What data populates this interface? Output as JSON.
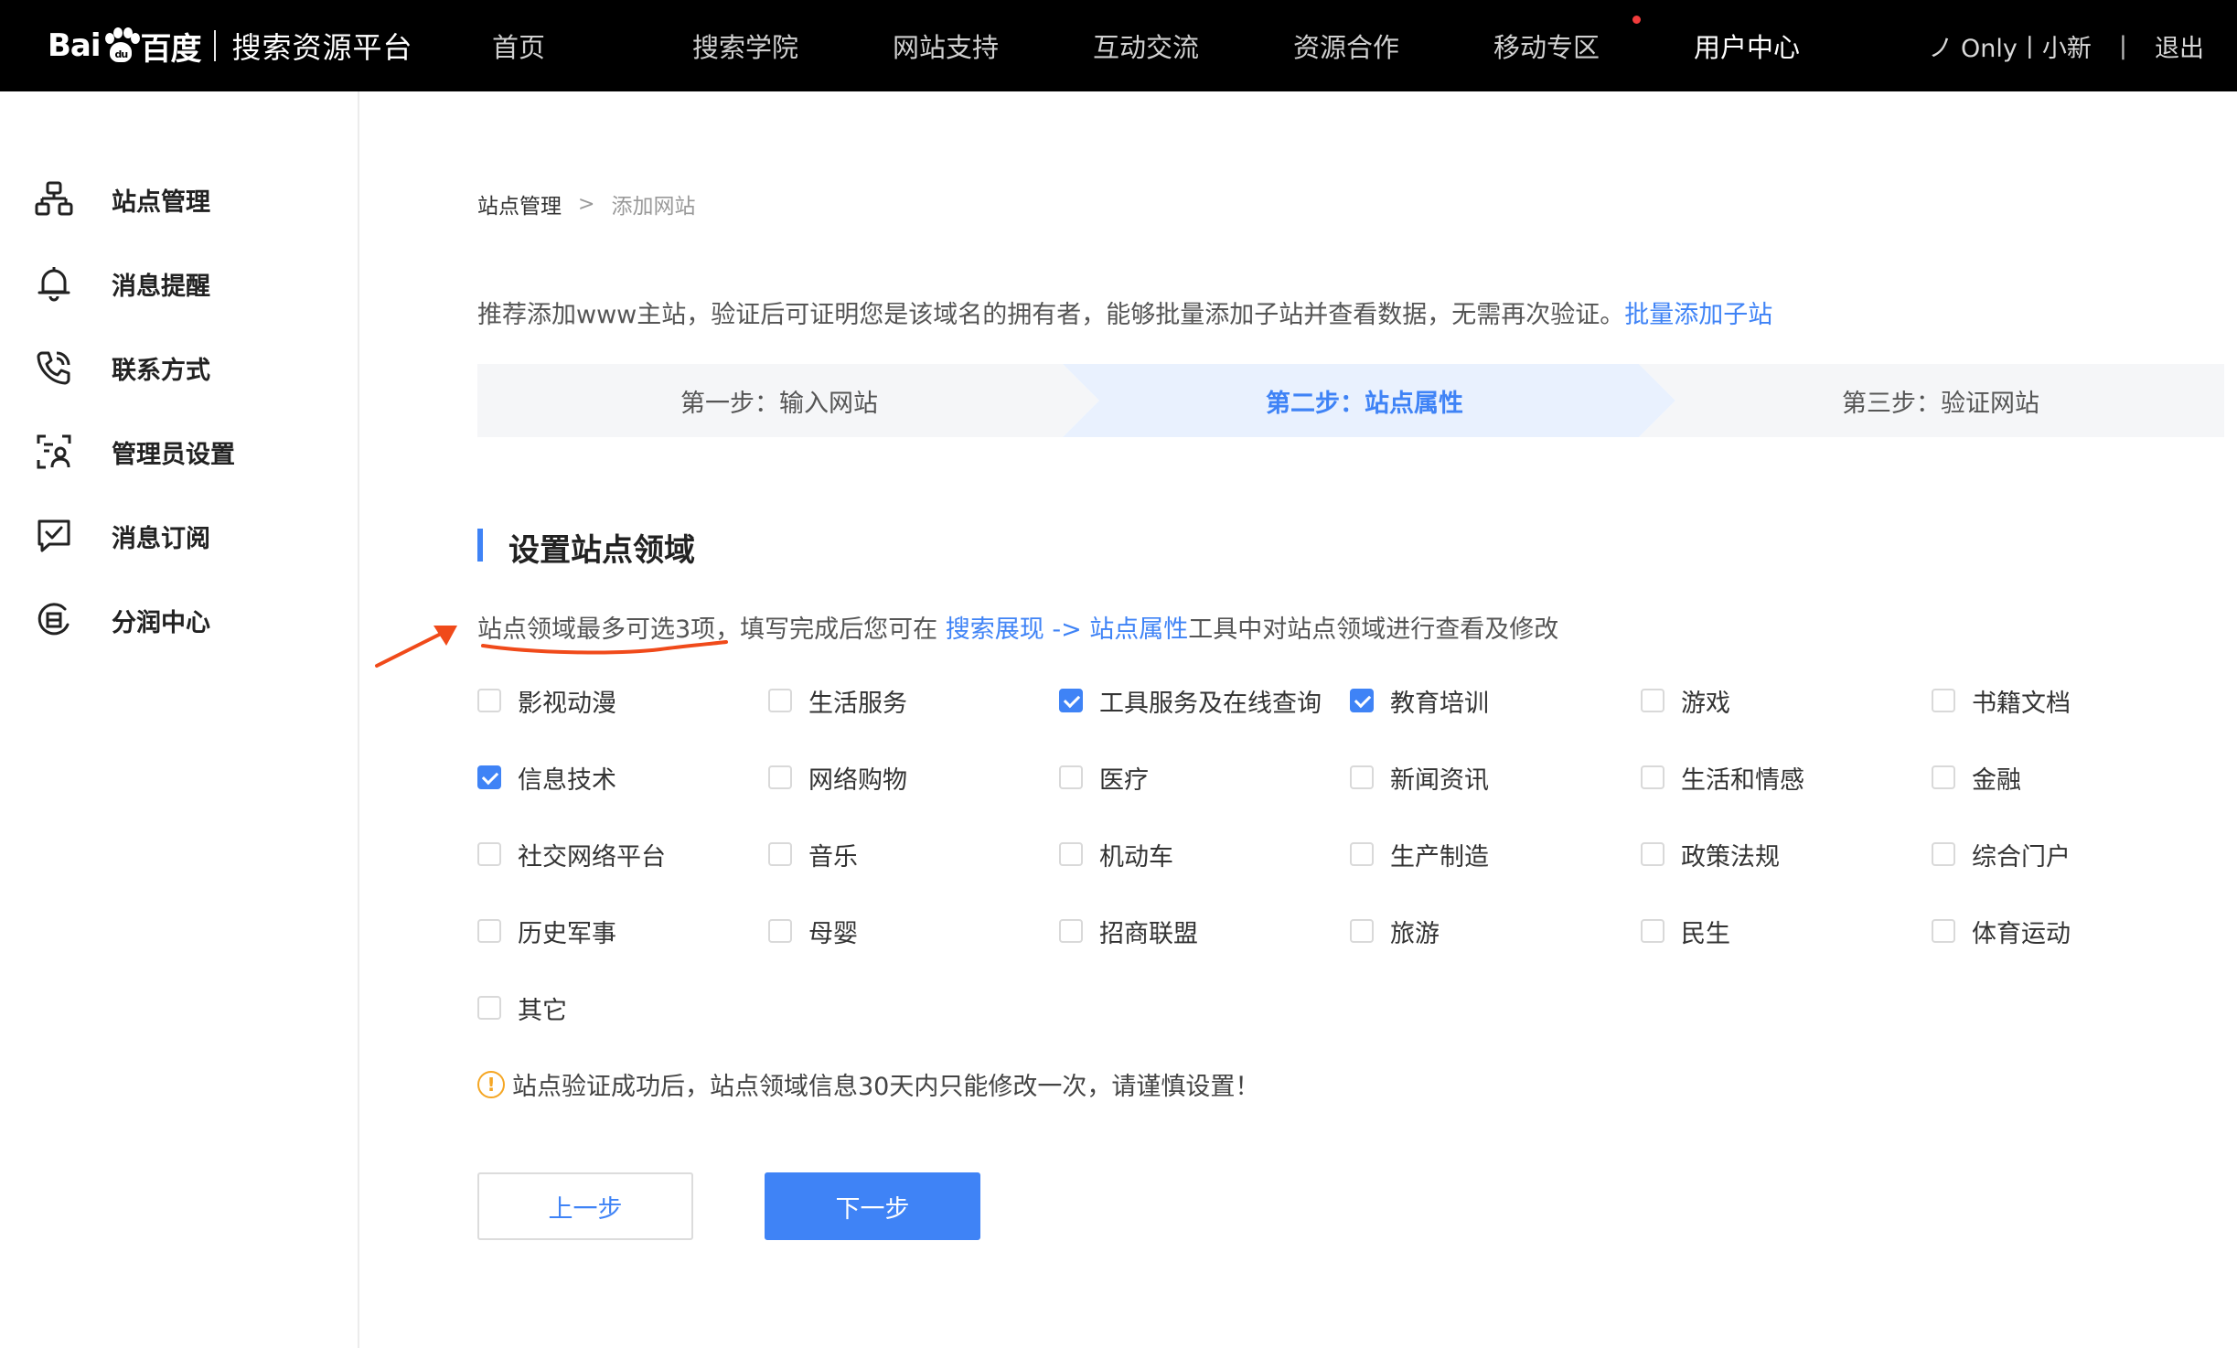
{
  "header": {
    "logo_text": "Bai百度",
    "platform_title": "搜索资源平台",
    "nav": [
      {
        "label": "首页",
        "active": false
      },
      {
        "label": "搜索学院",
        "active": false
      },
      {
        "label": "网站支持",
        "active": false
      },
      {
        "label": "互动交流",
        "active": false
      },
      {
        "label": "资源合作",
        "active": false
      },
      {
        "label": "移动专区",
        "active": false,
        "has_dot": true
      },
      {
        "label": "用户中心",
        "active": true
      }
    ],
    "user": "ノ Only丨小新",
    "separator": "|",
    "logout": "退出"
  },
  "sidebar": {
    "items": [
      {
        "label": "站点管理",
        "icon": "sitemap-icon"
      },
      {
        "label": "消息提醒",
        "icon": "bell-icon"
      },
      {
        "label": "联系方式",
        "icon": "phone-icon"
      },
      {
        "label": "管理员设置",
        "icon": "admin-icon"
      },
      {
        "label": "消息订阅",
        "icon": "subscribe-icon"
      },
      {
        "label": "分润中心",
        "icon": "profit-icon"
      }
    ]
  },
  "breadcrumb": {
    "parent": "站点管理",
    "separator": ">",
    "current": "添加网站"
  },
  "recommend": {
    "text": "推荐添加www主站，验证后可证明您是该域名的拥有者，能够批量添加子站并查看数据，无需再次验证。",
    "link": "批量添加子站"
  },
  "steps": [
    {
      "label": "第一步：输入网站",
      "active": false
    },
    {
      "label": "第二步：站点属性",
      "active": true
    },
    {
      "label": "第三步：验证网站",
      "active": false
    }
  ],
  "section": {
    "title": "设置站点领域",
    "hint_prefix": "站点领域最多可选3项，填写完成后您可在 ",
    "hint_link": "搜索展现 -> 站点属性",
    "hint_suffix": "工具中对站点领域进行查看及修改"
  },
  "domains": [
    {
      "label": "影视动漫",
      "checked": false
    },
    {
      "label": "生活服务",
      "checked": false
    },
    {
      "label": "工具服务及在线查询",
      "checked": true
    },
    {
      "label": "教育培训",
      "checked": true
    },
    {
      "label": "游戏",
      "checked": false
    },
    {
      "label": "书籍文档",
      "checked": false
    },
    {
      "label": "信息技术",
      "checked": true
    },
    {
      "label": "网络购物",
      "checked": false
    },
    {
      "label": "医疗",
      "checked": false
    },
    {
      "label": "新闻资讯",
      "checked": false
    },
    {
      "label": "生活和情感",
      "checked": false
    },
    {
      "label": "金融",
      "checked": false
    },
    {
      "label": "社交网络平台",
      "checked": false
    },
    {
      "label": "音乐",
      "checked": false
    },
    {
      "label": "机动车",
      "checked": false
    },
    {
      "label": "生产制造",
      "checked": false
    },
    {
      "label": "政策法规",
      "checked": false
    },
    {
      "label": "综合门户",
      "checked": false
    },
    {
      "label": "历史军事",
      "checked": false
    },
    {
      "label": "母婴",
      "checked": false
    },
    {
      "label": "招商联盟",
      "checked": false
    },
    {
      "label": "旅游",
      "checked": false
    },
    {
      "label": "民生",
      "checked": false
    },
    {
      "label": "体育运动",
      "checked": false
    },
    {
      "label": "其它",
      "checked": false
    }
  ],
  "warning": {
    "icon": "!",
    "text": "站点验证成功后，站点领域信息30天内只能修改一次，请谨慎设置！"
  },
  "buttons": {
    "prev": "上一步",
    "next": "下一步"
  },
  "colors": {
    "accent": "#3f83f6",
    "topbar": "#000000",
    "annotation": "#f04a1a",
    "warning": "#f5a623"
  }
}
